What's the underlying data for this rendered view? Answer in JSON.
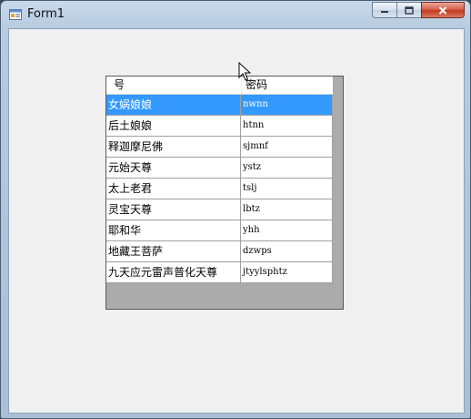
{
  "window": {
    "title": "Form1"
  },
  "grid": {
    "columns": [
      "号",
      "密码"
    ],
    "rows": [
      {
        "name": "女娲娘娘",
        "password": "nwnn",
        "selected": true
      },
      {
        "name": "后土娘娘",
        "password": "htnn",
        "selected": false
      },
      {
        "name": "释迦摩尼佛",
        "password": "sjmnf",
        "selected": false
      },
      {
        "name": "元始天尊",
        "password": "ystz",
        "selected": false
      },
      {
        "name": "太上老君",
        "password": "tslj",
        "selected": false
      },
      {
        "name": "灵宝天尊",
        "password": "lbtz",
        "selected": false
      },
      {
        "name": "耶和华",
        "password": "yhh",
        "selected": false
      },
      {
        "name": "地藏王菩萨",
        "password": "dzwps",
        "selected": false
      },
      {
        "name": "九天应元雷声普化天尊",
        "password": "jtyylsphtz",
        "selected": false
      }
    ]
  },
  "colors": {
    "selection": "#3399ff",
    "grid_background": "#ababab"
  },
  "icons": {
    "app": "form-app-icon",
    "cursor": "mouse-pointer-icon"
  }
}
